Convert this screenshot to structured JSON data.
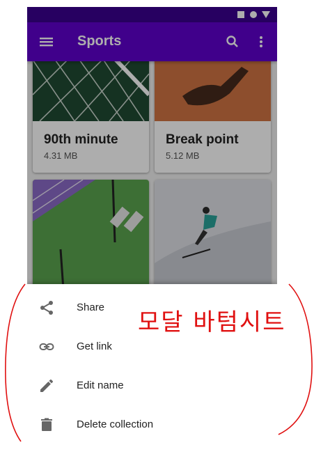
{
  "app_bar": {
    "title": "Sports",
    "menu_icon": "menu-icon",
    "search_icon": "search-icon",
    "more_icon": "more-vert-icon"
  },
  "cards": [
    {
      "name": "90th minute",
      "size": "4.31 MB",
      "image": "soccer-goal-net"
    },
    {
      "name": "Break point",
      "size": "5.12 MB",
      "image": "clay-tennis-court-shadow"
    },
    {
      "name": "",
      "size": "",
      "image": "aerial-tennis-court"
    },
    {
      "name": "",
      "size": "",
      "image": "skier-on-slope"
    }
  ],
  "bottom_sheet": {
    "items": [
      {
        "label": "Share",
        "icon": "share-icon"
      },
      {
        "label": "Get link",
        "icon": "link-icon"
      },
      {
        "label": "Edit name",
        "icon": "edit-icon"
      },
      {
        "label": "Delete collection",
        "icon": "delete-icon"
      }
    ]
  },
  "annotation": {
    "text": "모달 바텀시트",
    "color": "#e01010"
  },
  "colors": {
    "status_bar": "#3a018f",
    "app_bar": "#5f00cd",
    "scrim": "rgba(0,0,0,0.32)"
  }
}
